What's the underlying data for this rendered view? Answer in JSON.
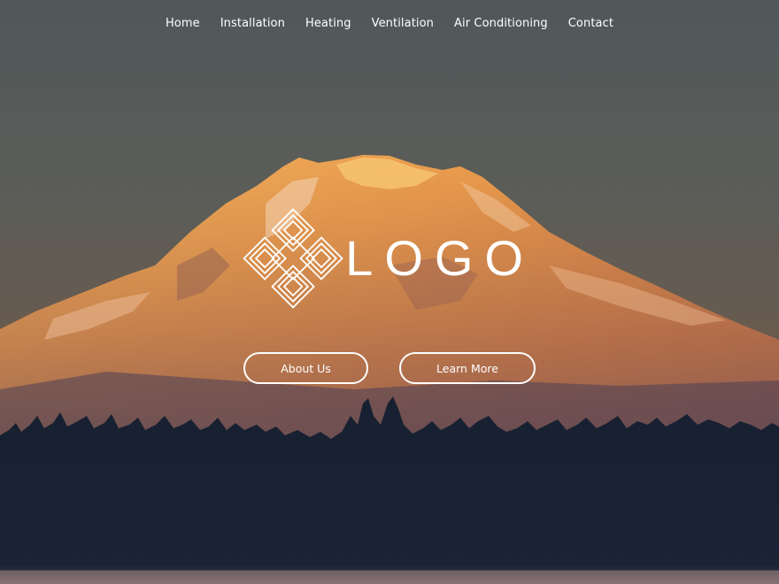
{
  "nav": {
    "items": [
      {
        "label": "Home"
      },
      {
        "label": "Installation"
      },
      {
        "label": "Heating"
      },
      {
        "label": "Ventilation"
      },
      {
        "label": "Air Conditioning"
      },
      {
        "label": "Contact"
      }
    ]
  },
  "logo": {
    "text": "LOGO",
    "mark_icon": "interlocking-diamonds-icon"
  },
  "actions": {
    "about_label": "About Us",
    "learn_label": "Learn More"
  },
  "background": {
    "subject": "mountain-at-sunset-photo",
    "sky_color": "#5a5f5c",
    "mountain_glow_color": "#d9833f",
    "forest_color": "#141c2a"
  }
}
